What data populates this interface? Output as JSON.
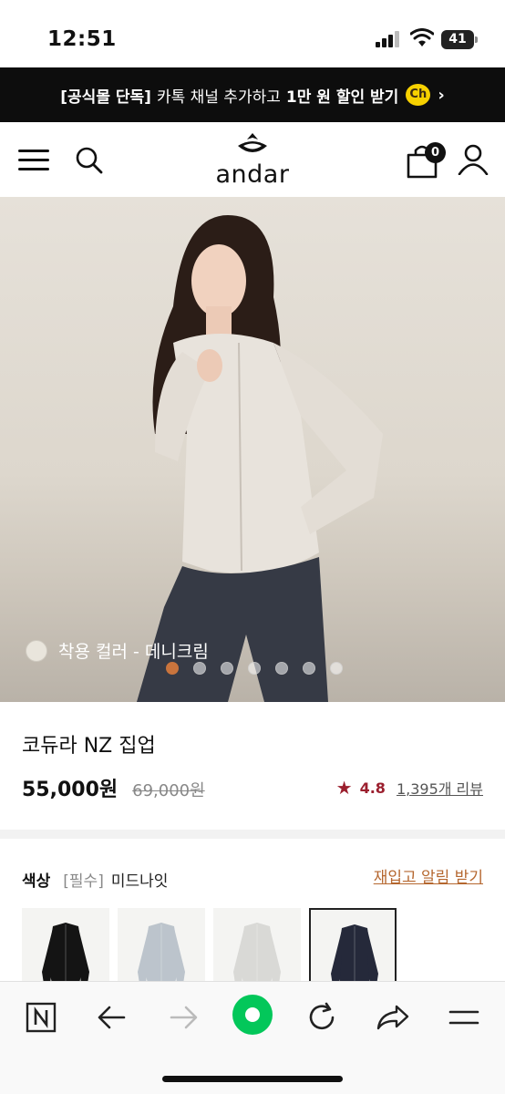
{
  "status_bar": {
    "time": "12:51",
    "battery": "41"
  },
  "promo": {
    "tag": "[공식몰 단독]",
    "text": "카톡 채널 추가하고",
    "bold": "1만 원 할인 받기",
    "channel_badge": "Ch",
    "chevron": "›"
  },
  "header": {
    "logo_text": "andar",
    "cart_count": "0"
  },
  "hero": {
    "color_label": "착용 컬러 - 데니크림",
    "slide_count": 7,
    "active_slide": 1
  },
  "product": {
    "name": "코듀라 NZ 집업",
    "price": "55,000원",
    "original_price": "69,000원",
    "rating": "4.8",
    "review_text": "1,395개 리뷰"
  },
  "options": {
    "title": "색상",
    "required": "[필수]",
    "selected_value": "미드나잇",
    "restock_link": "재입고 알림 받기",
    "swatches": [
      {
        "color": "#141414"
      },
      {
        "color": "#bcc4cc"
      },
      {
        "color": "#d9d9d6"
      },
      {
        "color": "#25293a"
      }
    ],
    "selected_index": 3
  },
  "icons": {
    "menu": "menu-icon",
    "search": "search-icon",
    "cart": "cart-icon",
    "user": "user-icon",
    "n_home": "n-icon",
    "back": "arrow-left-icon",
    "forward": "arrow-right-icon",
    "green_dot": "green-circle-icon",
    "refresh": "refresh-icon",
    "share": "share-icon",
    "more": "menu-lines-icon"
  },
  "colors": {
    "accent_orange": "#c9743d",
    "rating_red": "#9b1f2e",
    "naver_green": "#03c75a"
  }
}
